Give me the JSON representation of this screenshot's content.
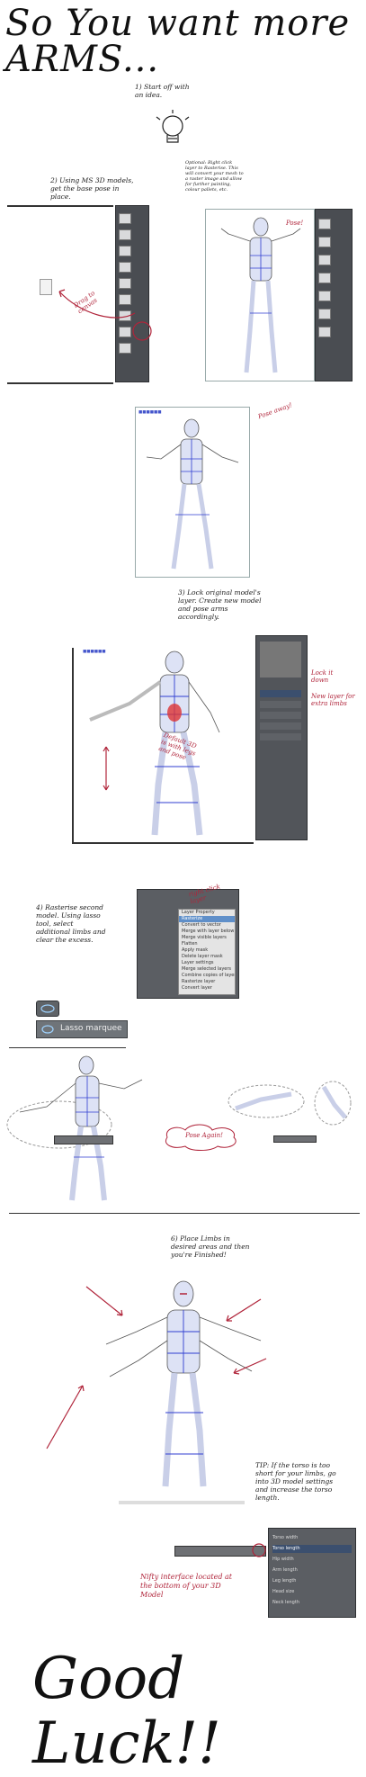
{
  "title": "So You want more ARMS...",
  "steps": {
    "step1": "1) Start off with an idea.",
    "step2": "2) Using MS 3D models, get the base pose in place.",
    "optional": "Optional: Right click layer to Rasterise. This will convert your mesh to a raster image and allow for further painting, colour pallets, etc.",
    "pose": "Pose!",
    "drag_to_canvas": "Drag to canvas",
    "pose_away": "Pose away!",
    "step3": "3) Lock original model's layer. Create new model and pose arms accordingly.",
    "lock_it_down": "Lock it down",
    "new_layer_for_limbs": "New layer for extra limbs",
    "default_3d": "Default 3D is with legs and pose",
    "step4": "4) Rasterise second model. Using lasso tool, select additional limbs and clear the excess.",
    "right_click_layer": "right click layer",
    "lasso_label": "Lasso marquee",
    "pose_again": "Pose Again!",
    "step6": "6) Place Limbs in desired areas and then you're Finished!",
    "tip": "TIP: If the torso is too short for your limbs, go into 3D model settings and increase the torso length.",
    "nifty": "Nifty interface located at the bottom of your 3D Model",
    "good_luck": "Good Luck!!"
  },
  "menu_items": [
    "Layer Property",
    "Rasterize",
    "Convert to vector",
    "Merge with layer below",
    "Merge visible layers",
    "Flatten",
    "Apply mask",
    "Delete layer mask",
    "Layer settings",
    "Merge selected layers",
    "Combine copies of layers",
    "Rasterize layer",
    "Convert layer"
  ],
  "settings_rows": [
    "Torso width",
    "Torso length",
    "Hip width",
    "Arm length",
    "Leg length",
    "Head size",
    "Neck length"
  ],
  "colors": {
    "ink": "#111111",
    "red_note": "#b0243a",
    "mesh_blue": "#2f3ed1",
    "ui_gray": "#4a4d52"
  },
  "icons": {
    "lightbulb": "lightbulb-icon"
  }
}
